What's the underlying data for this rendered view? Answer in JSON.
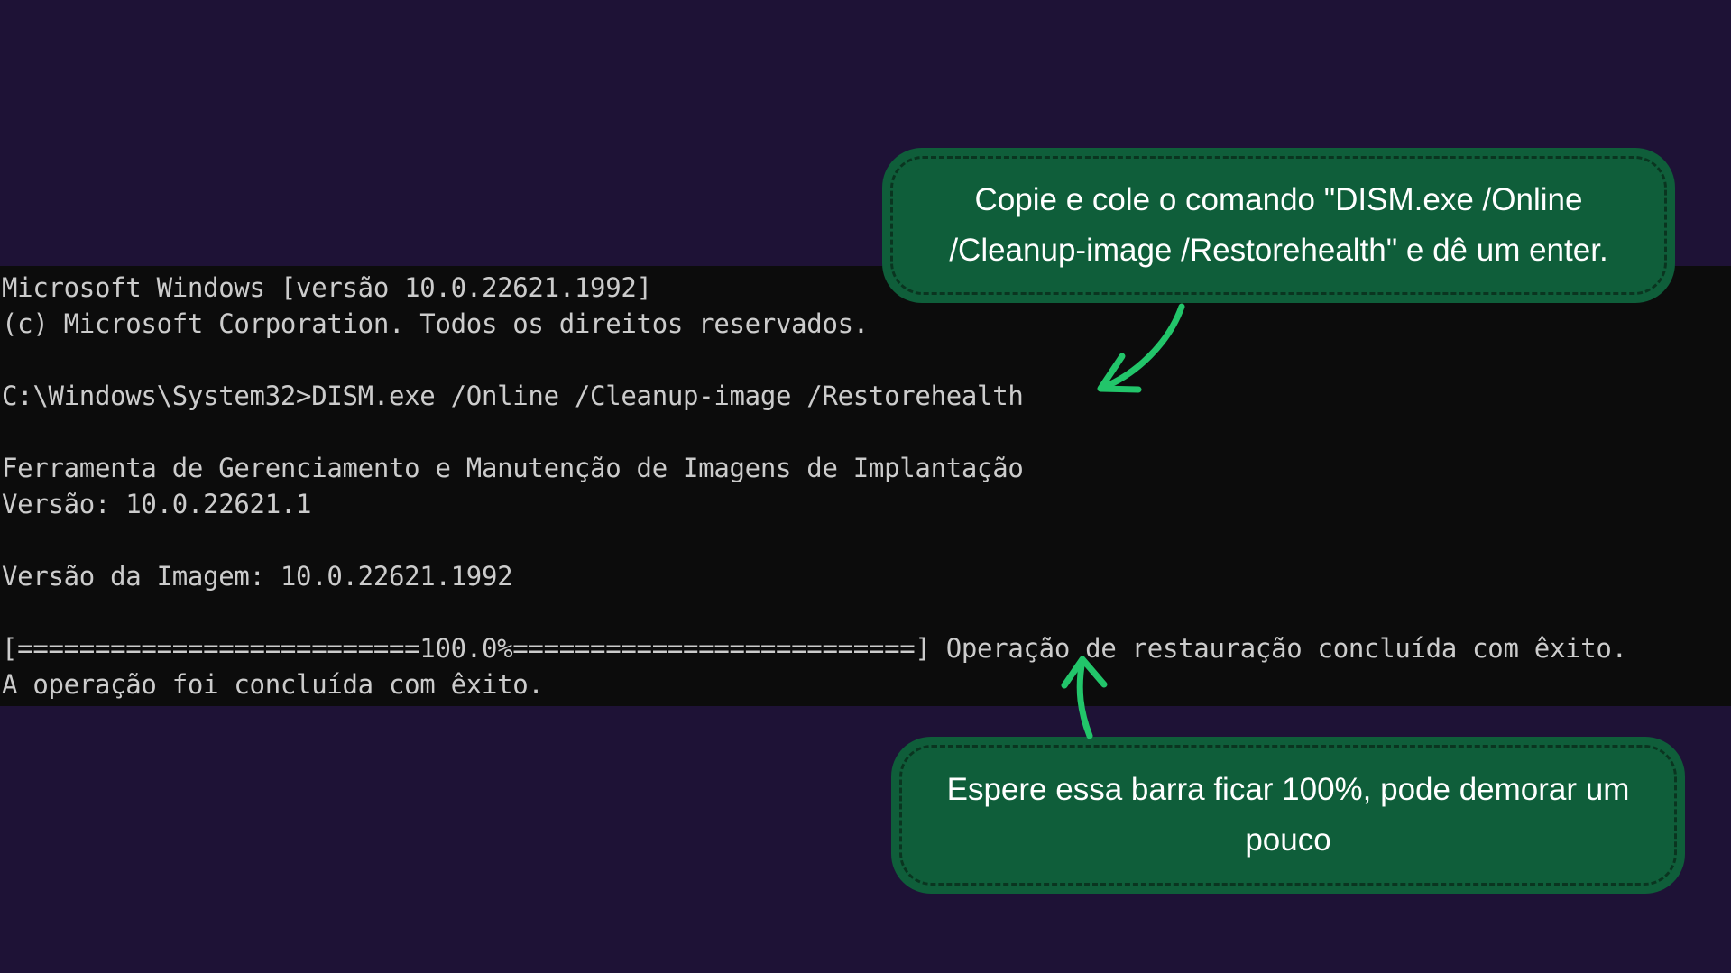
{
  "terminal": {
    "lines": [
      "Microsoft Windows [versão 10.0.22621.1992]",
      "(c) Microsoft Corporation. Todos os direitos reservados.",
      "",
      "C:\\Windows\\System32>DISM.exe /Online /Cleanup-image /Restorehealth",
      "",
      "Ferramenta de Gerenciamento e Manutenção de Imagens de Implantação",
      "Versão: 10.0.22621.1",
      "",
      "Versão da Imagem: 10.0.22621.1992",
      "",
      "[==========================100.0%==========================] Operação de restauração concluída com êxito.",
      "A operação foi concluída com êxito."
    ],
    "progress_percent": 100
  },
  "callouts": {
    "top": {
      "line1": "Copie e cole o comando \"DISM.exe /Online",
      "line2": "/Cleanup-image /Restorehealth\" e dê um enter."
    },
    "bottom": {
      "line1": "Espere essa barra ficar 100%, pode demorar um",
      "line2": "pouco"
    }
  },
  "colors": {
    "background": "#1e1236",
    "terminal_bg": "#0c0c0c",
    "terminal_text": "#cccccc",
    "callout_bg": "#0f5e3a",
    "arrow": "#22c56a"
  }
}
